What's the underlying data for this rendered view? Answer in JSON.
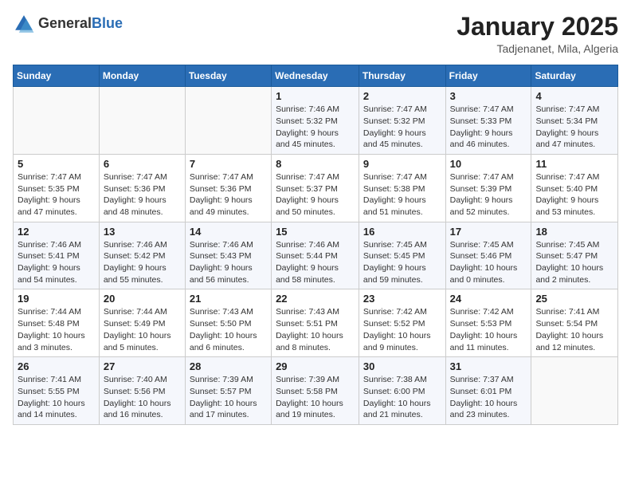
{
  "header": {
    "logo_general": "General",
    "logo_blue": "Blue",
    "title": "January 2025",
    "subtitle": "Tadjenanet, Mila, Algeria"
  },
  "days_of_week": [
    "Sunday",
    "Monday",
    "Tuesday",
    "Wednesday",
    "Thursday",
    "Friday",
    "Saturday"
  ],
  "weeks": [
    [
      {
        "day": "",
        "info": ""
      },
      {
        "day": "",
        "info": ""
      },
      {
        "day": "",
        "info": ""
      },
      {
        "day": "1",
        "info": "Sunrise: 7:46 AM\nSunset: 5:32 PM\nDaylight: 9 hours and 45 minutes."
      },
      {
        "day": "2",
        "info": "Sunrise: 7:47 AM\nSunset: 5:32 PM\nDaylight: 9 hours and 45 minutes."
      },
      {
        "day": "3",
        "info": "Sunrise: 7:47 AM\nSunset: 5:33 PM\nDaylight: 9 hours and 46 minutes."
      },
      {
        "day": "4",
        "info": "Sunrise: 7:47 AM\nSunset: 5:34 PM\nDaylight: 9 hours and 47 minutes."
      }
    ],
    [
      {
        "day": "5",
        "info": "Sunrise: 7:47 AM\nSunset: 5:35 PM\nDaylight: 9 hours and 47 minutes."
      },
      {
        "day": "6",
        "info": "Sunrise: 7:47 AM\nSunset: 5:36 PM\nDaylight: 9 hours and 48 minutes."
      },
      {
        "day": "7",
        "info": "Sunrise: 7:47 AM\nSunset: 5:36 PM\nDaylight: 9 hours and 49 minutes."
      },
      {
        "day": "8",
        "info": "Sunrise: 7:47 AM\nSunset: 5:37 PM\nDaylight: 9 hours and 50 minutes."
      },
      {
        "day": "9",
        "info": "Sunrise: 7:47 AM\nSunset: 5:38 PM\nDaylight: 9 hours and 51 minutes."
      },
      {
        "day": "10",
        "info": "Sunrise: 7:47 AM\nSunset: 5:39 PM\nDaylight: 9 hours and 52 minutes."
      },
      {
        "day": "11",
        "info": "Sunrise: 7:47 AM\nSunset: 5:40 PM\nDaylight: 9 hours and 53 minutes."
      }
    ],
    [
      {
        "day": "12",
        "info": "Sunrise: 7:46 AM\nSunset: 5:41 PM\nDaylight: 9 hours and 54 minutes."
      },
      {
        "day": "13",
        "info": "Sunrise: 7:46 AM\nSunset: 5:42 PM\nDaylight: 9 hours and 55 minutes."
      },
      {
        "day": "14",
        "info": "Sunrise: 7:46 AM\nSunset: 5:43 PM\nDaylight: 9 hours and 56 minutes."
      },
      {
        "day": "15",
        "info": "Sunrise: 7:46 AM\nSunset: 5:44 PM\nDaylight: 9 hours and 58 minutes."
      },
      {
        "day": "16",
        "info": "Sunrise: 7:45 AM\nSunset: 5:45 PM\nDaylight: 9 hours and 59 minutes."
      },
      {
        "day": "17",
        "info": "Sunrise: 7:45 AM\nSunset: 5:46 PM\nDaylight: 10 hours and 0 minutes."
      },
      {
        "day": "18",
        "info": "Sunrise: 7:45 AM\nSunset: 5:47 PM\nDaylight: 10 hours and 2 minutes."
      }
    ],
    [
      {
        "day": "19",
        "info": "Sunrise: 7:44 AM\nSunset: 5:48 PM\nDaylight: 10 hours and 3 minutes."
      },
      {
        "day": "20",
        "info": "Sunrise: 7:44 AM\nSunset: 5:49 PM\nDaylight: 10 hours and 5 minutes."
      },
      {
        "day": "21",
        "info": "Sunrise: 7:43 AM\nSunset: 5:50 PM\nDaylight: 10 hours and 6 minutes."
      },
      {
        "day": "22",
        "info": "Sunrise: 7:43 AM\nSunset: 5:51 PM\nDaylight: 10 hours and 8 minutes."
      },
      {
        "day": "23",
        "info": "Sunrise: 7:42 AM\nSunset: 5:52 PM\nDaylight: 10 hours and 9 minutes."
      },
      {
        "day": "24",
        "info": "Sunrise: 7:42 AM\nSunset: 5:53 PM\nDaylight: 10 hours and 11 minutes."
      },
      {
        "day": "25",
        "info": "Sunrise: 7:41 AM\nSunset: 5:54 PM\nDaylight: 10 hours and 12 minutes."
      }
    ],
    [
      {
        "day": "26",
        "info": "Sunrise: 7:41 AM\nSunset: 5:55 PM\nDaylight: 10 hours and 14 minutes."
      },
      {
        "day": "27",
        "info": "Sunrise: 7:40 AM\nSunset: 5:56 PM\nDaylight: 10 hours and 16 minutes."
      },
      {
        "day": "28",
        "info": "Sunrise: 7:39 AM\nSunset: 5:57 PM\nDaylight: 10 hours and 17 minutes."
      },
      {
        "day": "29",
        "info": "Sunrise: 7:39 AM\nSunset: 5:58 PM\nDaylight: 10 hours and 19 minutes."
      },
      {
        "day": "30",
        "info": "Sunrise: 7:38 AM\nSunset: 6:00 PM\nDaylight: 10 hours and 21 minutes."
      },
      {
        "day": "31",
        "info": "Sunrise: 7:37 AM\nSunset: 6:01 PM\nDaylight: 10 hours and 23 minutes."
      },
      {
        "day": "",
        "info": ""
      }
    ]
  ]
}
